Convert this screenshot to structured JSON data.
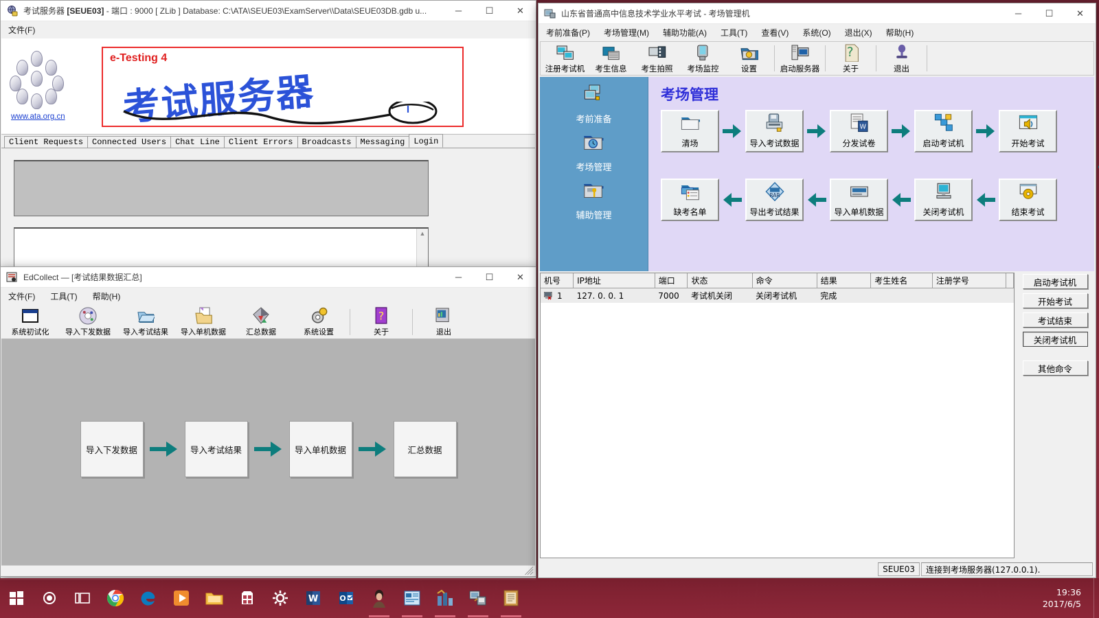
{
  "desktop": {
    "taskbar": {
      "start_label": "start",
      "icons": [
        {
          "name": "start-button",
          "glyph": "windows"
        },
        {
          "name": "cortana-icon",
          "glyph": "circle"
        },
        {
          "name": "task-view-icon",
          "glyph": "taskview"
        },
        {
          "name": "chrome-icon",
          "glyph": "chrome"
        },
        {
          "name": "edge-icon",
          "glyph": "edge"
        },
        {
          "name": "media-player-icon",
          "glyph": "mediaplayer"
        },
        {
          "name": "file-explorer-icon",
          "glyph": "folder"
        },
        {
          "name": "store-icon",
          "glyph": "store"
        },
        {
          "name": "settings-icon",
          "glyph": "gear"
        },
        {
          "name": "word-icon",
          "glyph": "word"
        },
        {
          "name": "outlook-icon",
          "glyph": "outlook"
        },
        {
          "name": "photo-app-icon",
          "glyph": "photo"
        },
        {
          "name": "exam-server-icon",
          "glyph": "examserver"
        },
        {
          "name": "edcollect-icon",
          "glyph": "edcollect"
        },
        {
          "name": "exam-room-icon",
          "glyph": "examroom"
        },
        {
          "name": "dictionary-icon",
          "glyph": "book"
        }
      ],
      "clock_time": "19:36",
      "clock_date": "2017/6/5"
    }
  },
  "exam_server_window": {
    "title_main": "考试服务器",
    "title_tag": "[SEUE03]",
    "title_rest": " - 端口 : 9000 [ ZLib ] Database: C:\\ATA\\SEUE03\\ExamServer\\\\Data\\SEUE03DB.gdb  u...",
    "minimize": "─",
    "maximize": "☐",
    "close": "✕",
    "menu": [
      "文件(F)"
    ],
    "banner": {
      "etesting": "e-Testing 4",
      "chinese": "考试服务器",
      "url": "www.ata.org.cn"
    },
    "tabs": [
      {
        "label": "Client Requests",
        "active": false
      },
      {
        "label": "Connected Users",
        "active": false
      },
      {
        "label": "Chat Line",
        "active": false
      },
      {
        "label": "Client Errors",
        "active": false
      },
      {
        "label": "Broadcasts",
        "active": false
      },
      {
        "label": "Messaging",
        "active": false
      },
      {
        "label": "Login",
        "active": true
      }
    ],
    "log_text": "",
    "input_text": ""
  },
  "edcollect_window": {
    "title": "EdCollect — [考试结果数据汇总]",
    "minimize": "─",
    "maximize": "☐",
    "close": "✕",
    "menu": [
      "文件(F)",
      "工具(T)",
      "帮助(H)"
    ],
    "toolbar": [
      {
        "label": "系统初试化",
        "icon": "window-init-icon"
      },
      {
        "label": "导入下发数据",
        "icon": "cd-disc-icon"
      },
      {
        "label": "导入考试结果",
        "icon": "open-folder-icon"
      },
      {
        "label": "导入单机数据",
        "icon": "folder-doc-icon"
      },
      {
        "label": "汇总数据",
        "icon": "diamond-icon"
      },
      {
        "label": "系统设置",
        "icon": "gear-icon"
      },
      {
        "label": "关于",
        "icon": "question-icon"
      },
      {
        "label": "退出",
        "icon": "exit-monitor-icon"
      }
    ],
    "flow": [
      {
        "label": "导入下发数据"
      },
      {
        "label": "导入考试结果"
      },
      {
        "label": "导入单机数据"
      },
      {
        "label": "汇总数据"
      }
    ],
    "arrow_color": "#0d7d7d"
  },
  "exam_room_window": {
    "title": "山东省普通高中信息技术学业水平考试 - 考场管理机",
    "minimize": "─",
    "maximize": "☐",
    "close": "✕",
    "menu": [
      "考前准备(P)",
      "考场管理(M)",
      "辅助功能(A)",
      "工具(T)",
      "查看(V)",
      "系统(O)",
      "退出(X)",
      "帮助(H)"
    ],
    "toolbar": [
      {
        "label": "注册考试机",
        "icon": "register-pc-icon"
      },
      {
        "label": "考生信息",
        "icon": "student-folder-icon"
      },
      {
        "label": "考生拍照",
        "icon": "camera-film-icon"
      },
      {
        "label": "考场监控",
        "icon": "monitor-icon"
      },
      {
        "label": "设置",
        "icon": "settings-folder-icon"
      },
      {
        "label": "启动服务器",
        "icon": "server-icon"
      },
      {
        "label": "关于",
        "icon": "question-page-icon"
      },
      {
        "label": "退出",
        "icon": "stamp-exit-icon"
      }
    ],
    "sidebar": [
      {
        "label": "考前准备",
        "icon": "two-pcs-icon"
      },
      {
        "label": "考场管理",
        "icon": "clock-folder-icon"
      },
      {
        "label": "辅助管理",
        "icon": "key-folder-icon"
      }
    ],
    "panel_title": "考场管理",
    "workflow_top": [
      {
        "label": "清场",
        "icon": "empty-folder-icon"
      },
      {
        "label": "导入考试数据",
        "icon": "floppy-import-icon"
      },
      {
        "label": "分发试卷",
        "icon": "paper-w-icon"
      },
      {
        "label": "启动考试机",
        "icon": "network-nodes-icon"
      },
      {
        "label": "开始考试",
        "icon": "speaker-window-icon"
      }
    ],
    "workflow_bottom": [
      {
        "label": "缺考名单",
        "icon": "list-folder-icon"
      },
      {
        "label": "导出考试结果",
        "icon": "rar-icon"
      },
      {
        "label": "导入单机数据",
        "icon": "drive-icon"
      },
      {
        "label": "关闭考试机",
        "icon": "shutdown-pc-icon"
      },
      {
        "label": "结束考试",
        "icon": "cd-window-icon"
      }
    ],
    "accent_color": "#0d7d7d",
    "panel_bg": "#e0d8f6",
    "sidebar_bg": "#5f9dc8",
    "client_table": {
      "columns": [
        "机号",
        "IP地址",
        "端口",
        "状态",
        "命令",
        "结果",
        "考生姓名",
        "注册学号",
        ""
      ],
      "rows": [
        {
          "机号": "1",
          "IP地址": "127. 0. 0. 1",
          "端口": "7000",
          "状态": "考试机关闭",
          "命令": "关闭考试机",
          "结果": "完成",
          "考生姓名": "",
          "注册学号": "",
          "": ""
        }
      ]
    },
    "side_buttons": [
      {
        "label": "启动考试机",
        "pressed": false
      },
      {
        "label": "开始考试",
        "pressed": false
      },
      {
        "label": "考试结束",
        "pressed": false
      },
      {
        "label": "关闭考试机",
        "pressed": true
      },
      {
        "label": "其他命令",
        "pressed": false
      }
    ],
    "status": {
      "server_id": "SEUE03",
      "connection": "连接到考场服务器(127.0.0.1)."
    }
  }
}
